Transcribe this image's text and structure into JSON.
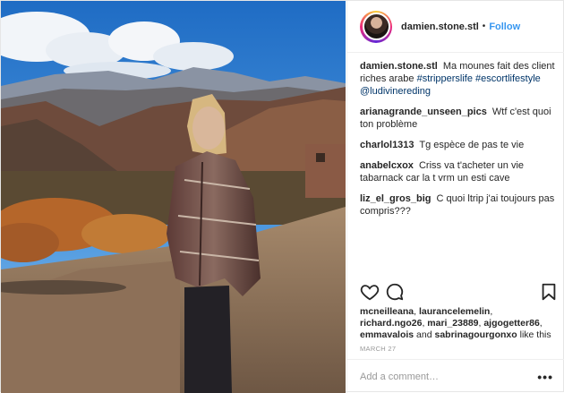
{
  "header": {
    "username": "damien.stone.stl",
    "separator": "•",
    "follow_label": "Follow"
  },
  "caption": {
    "username": "damien.stone.stl",
    "text": "Ma mounes fait des client riches arabe",
    "hashtags": [
      "#stripperslife",
      "#escortlifestyle"
    ],
    "mention": "@ludivinereding"
  },
  "comments": [
    {
      "username": "arianagrande_unseen_pics",
      "text": "Wtf c'est quoi ton problème"
    },
    {
      "username": "charlol1313",
      "text": "Tg espèce de pas te vie"
    },
    {
      "username": "anabelcxox",
      "text": "Criss va t'acheter un vie tabarnack car la t vrm un esti cave"
    },
    {
      "username": "liz_el_gros_big",
      "text": "C quoi ltrip j'ai toujours pas compris???"
    }
  ],
  "actions": {
    "like_icon": "heart-icon",
    "comment_icon": "comment-bubble-icon",
    "save_icon": "bookmark-icon"
  },
  "likes": {
    "users": [
      "mcneilleana",
      "laurancelemelin",
      "richard.ngo26",
      "mari_23889",
      "ajgogetter86",
      "emmavalois"
    ],
    "and_word": "and",
    "last_user": "sabrinagourgonxo",
    "suffix": "like this"
  },
  "date": "MARCH 27",
  "add_comment": {
    "placeholder": "Add a comment…",
    "more_label": "•••"
  },
  "colors": {
    "link_blue": "#3897f0",
    "hashtag": "#003569",
    "muted": "#999999"
  }
}
